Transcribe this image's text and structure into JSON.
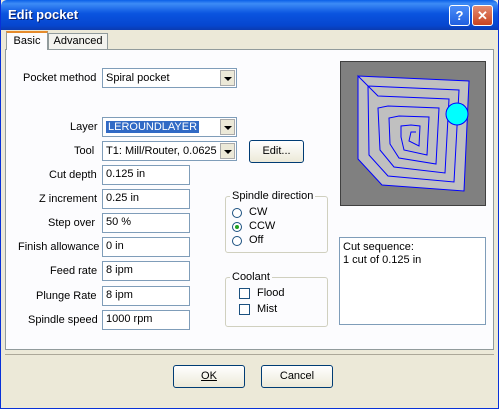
{
  "window": {
    "title": "Edit pocket",
    "help": "?",
    "close": "✕"
  },
  "tabs": {
    "basic": "Basic",
    "advanced": "Advanced"
  },
  "form": {
    "pocket_method_label": "Pocket method",
    "pocket_method_value": "Spiral pocket",
    "layer_label": "Layer",
    "layer_value": "LEROUNDLAYER",
    "tool_label": "Tool",
    "tool_value": "T1: Mill/Router, 0.0625",
    "edit_button": "Edit...",
    "cut_depth_label": "Cut depth",
    "cut_depth_value": "0.125 in",
    "z_increment_label": "Z increment",
    "z_increment_value": "0.25 in",
    "step_over_label": "Step over",
    "step_over_value": "50 %",
    "finish_allowance_label": "Finish allowance",
    "finish_allowance_value": "0 in",
    "feed_rate_label": "Feed rate",
    "feed_rate_value": "8 ipm",
    "plunge_rate_label": "Plunge Rate",
    "plunge_rate_value": "8 ipm",
    "spindle_speed_label": "Spindle speed",
    "spindle_speed_value": "1000 rpm"
  },
  "spindle_direction": {
    "title": "Spindle direction",
    "options": [
      "CW",
      "CCW",
      "Off"
    ],
    "selected": "CCW"
  },
  "coolant": {
    "title": "Coolant",
    "options": [
      "Flood",
      "Mist"
    ],
    "flood_checked": false,
    "mist_checked": false
  },
  "cut_sequence": {
    "line1": "Cut sequence:",
    "line2": "1 cut of 0.125 in"
  },
  "buttons": {
    "ok": "OK",
    "cancel": "Cancel"
  },
  "colors": {
    "toolpath": "#0000ff",
    "tool": "#00ffff",
    "preview_bg": "#808080",
    "pocket": "#c0c0c0"
  }
}
